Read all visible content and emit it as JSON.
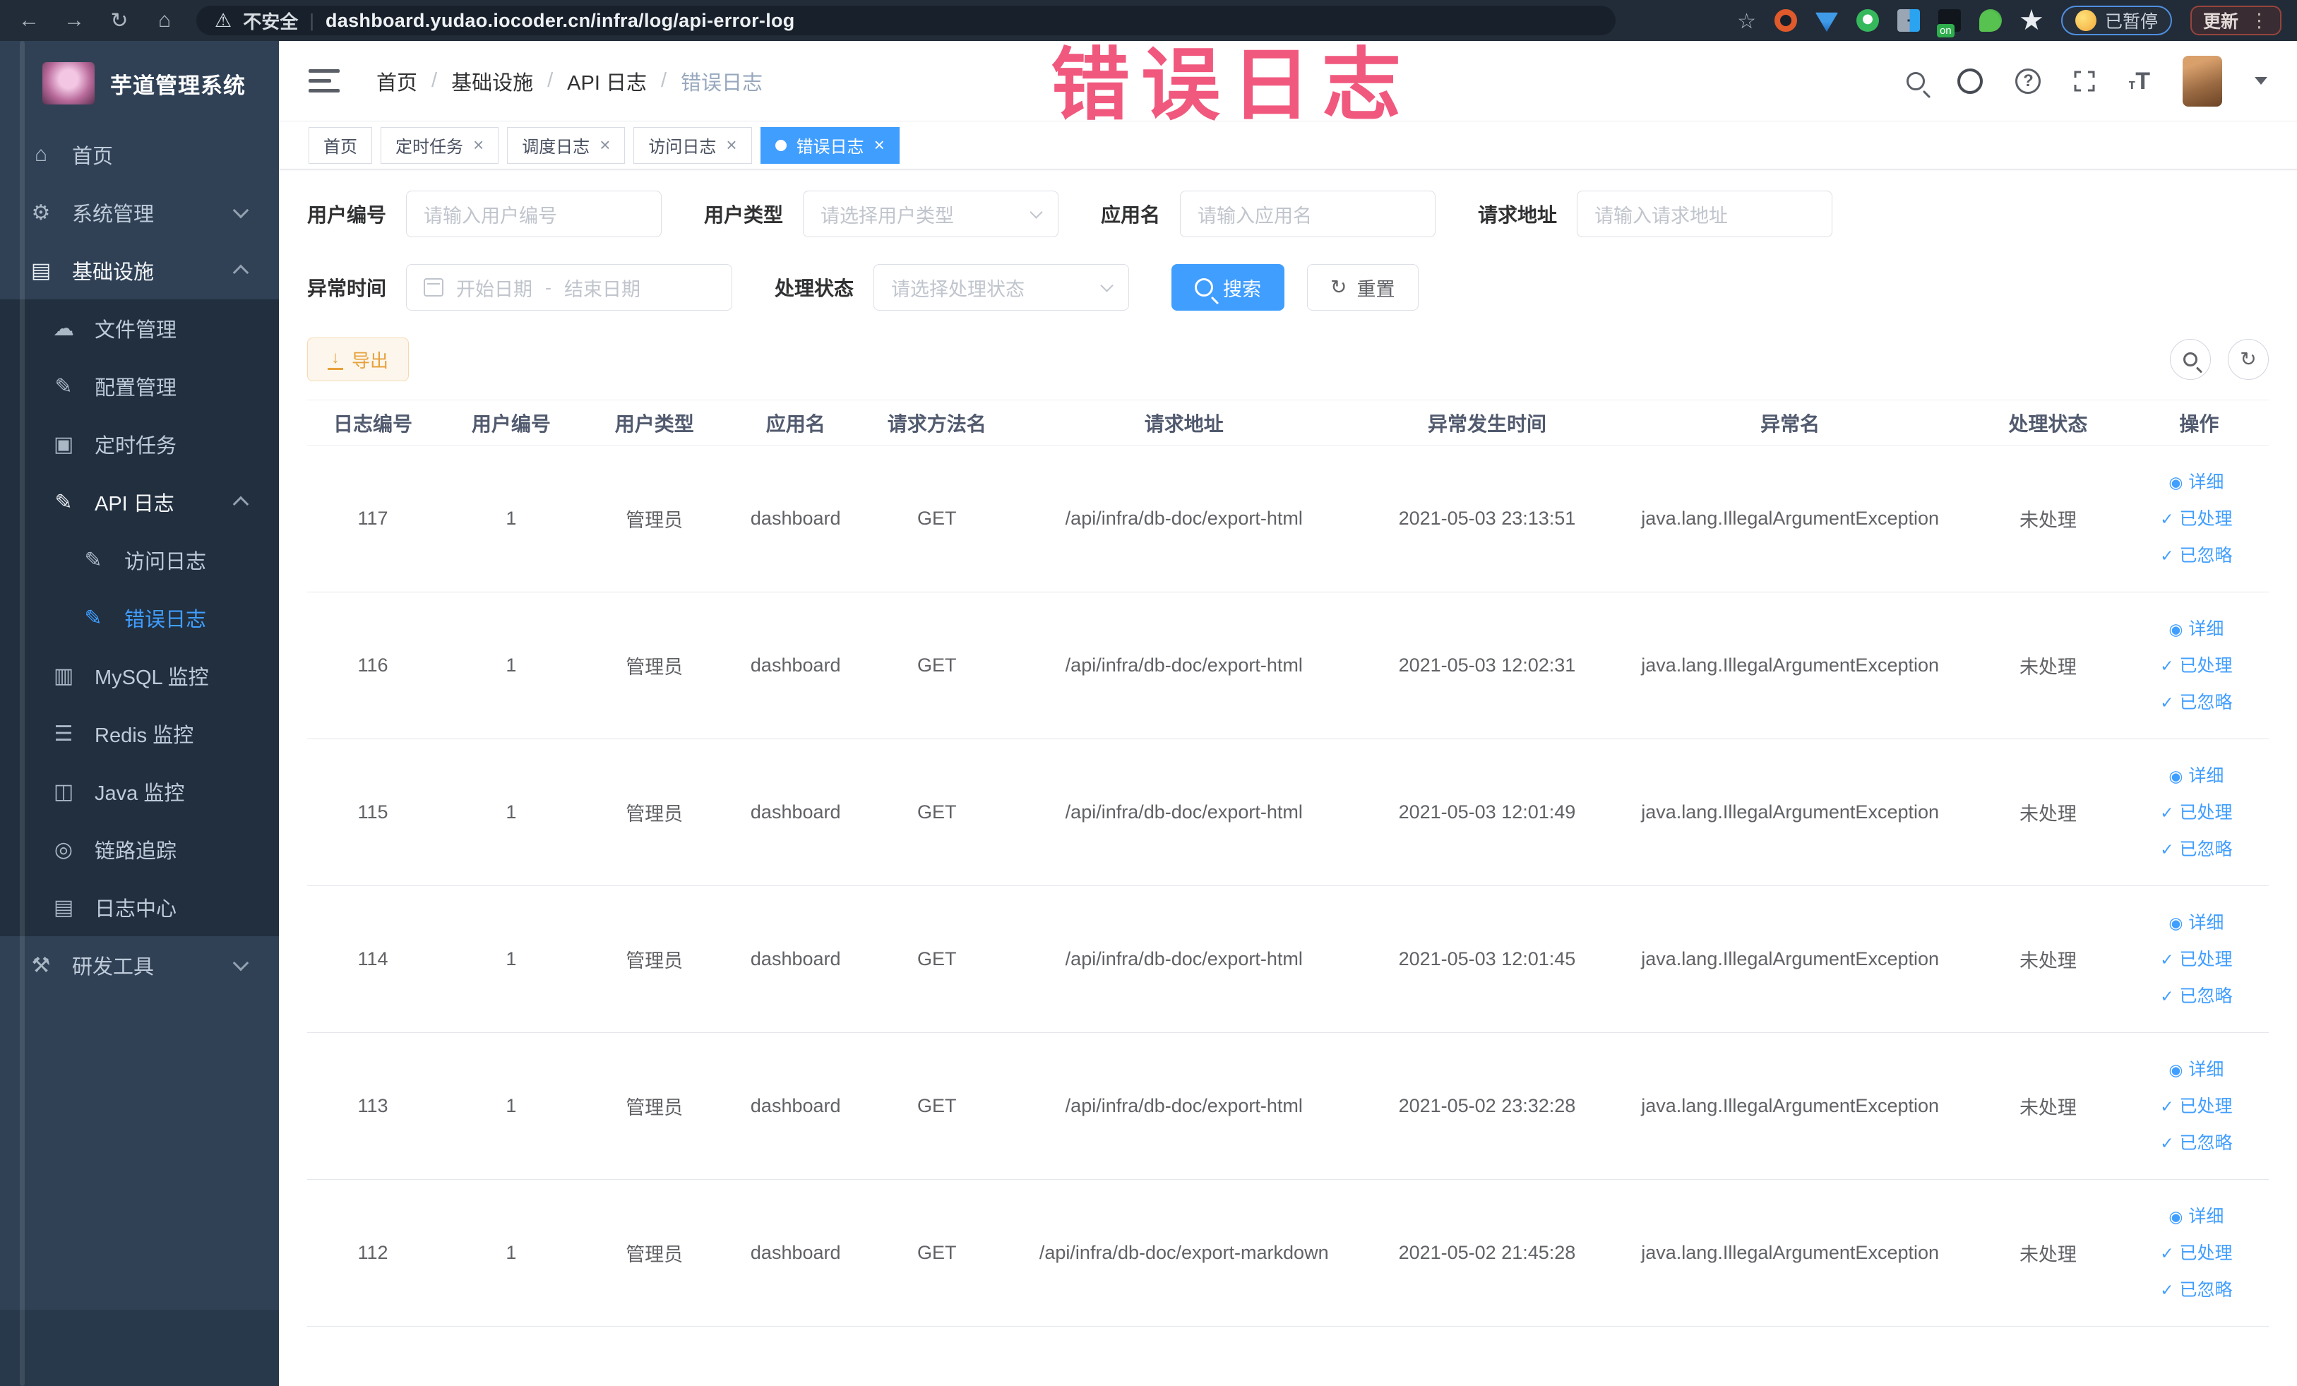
{
  "overlay": {
    "text": "错误日志"
  },
  "browser": {
    "security_label": "不安全",
    "url": "dashboard.yudao.iocoder.cn/infra/log/api-error-log",
    "paused_badge": "已暂停",
    "update_button": "更新"
  },
  "sidebar": {
    "title": "芋道管理系统",
    "items": [
      {
        "label": "首页",
        "icon": "home-icon",
        "glyph": "⌂",
        "level": 1,
        "sub": false
      },
      {
        "label": "系统管理",
        "icon": "gear-icon",
        "glyph": "⚙",
        "level": 1,
        "sub": false,
        "chevron": "down"
      },
      {
        "label": "基础设施",
        "icon": "monitor-icon",
        "glyph": "▤",
        "level": 1,
        "sub": false,
        "chevron": "up",
        "open": true
      },
      {
        "label": "文件管理",
        "icon": "cloud-upload-icon",
        "glyph": "☁",
        "level": 2,
        "sub": true
      },
      {
        "label": "配置管理",
        "icon": "edit-icon",
        "glyph": "✎",
        "level": 2,
        "sub": true
      },
      {
        "label": "定时任务",
        "icon": "task-icon",
        "glyph": "▣",
        "level": 2,
        "sub": true
      },
      {
        "label": "API 日志",
        "icon": "api-log-icon",
        "glyph": "✎",
        "level": 2,
        "sub": true,
        "chevron": "up",
        "open": true
      },
      {
        "label": "访问日志",
        "icon": "access-log-icon",
        "glyph": "✎",
        "level": 3,
        "sub": true
      },
      {
        "label": "错误日志",
        "icon": "error-log-icon",
        "glyph": "✎",
        "level": 3,
        "sub": true,
        "active": true
      },
      {
        "label": "MySQL 监控",
        "icon": "mysql-icon",
        "glyph": "▥",
        "level": 2,
        "sub": true
      },
      {
        "label": "Redis 监控",
        "icon": "redis-icon",
        "glyph": "☰",
        "level": 2,
        "sub": true
      },
      {
        "label": "Java 监控",
        "icon": "java-icon",
        "glyph": "◫",
        "level": 2,
        "sub": true
      },
      {
        "label": "链路追踪",
        "icon": "trace-icon",
        "glyph": "◎",
        "level": 2,
        "sub": true
      },
      {
        "label": "日志中心",
        "icon": "log-center-icon",
        "glyph": "▤",
        "level": 2,
        "sub": true
      },
      {
        "label": "研发工具",
        "icon": "toolbox-icon",
        "glyph": "⚒",
        "level": 1,
        "sub": false,
        "chevron": "down"
      }
    ]
  },
  "breadcrumb": {
    "items": [
      "首页",
      "基础设施",
      "API 日志",
      "错误日志"
    ]
  },
  "tags": [
    {
      "label": "首页",
      "closable": false,
      "active": false
    },
    {
      "label": "定时任务",
      "closable": true,
      "active": false
    },
    {
      "label": "调度日志",
      "closable": true,
      "active": false
    },
    {
      "label": "访问日志",
      "closable": true,
      "active": false
    },
    {
      "label": "错误日志",
      "closable": true,
      "active": true
    }
  ],
  "filters": {
    "user_id": {
      "label": "用户编号",
      "placeholder": "请输入用户编号"
    },
    "user_type": {
      "label": "用户类型",
      "placeholder": "请选择用户类型"
    },
    "app_name": {
      "label": "应用名",
      "placeholder": "请输入应用名"
    },
    "request_url": {
      "label": "请求地址",
      "placeholder": "请输入请求地址"
    },
    "exception_time": {
      "label": "异常时间",
      "start_placeholder": "开始日期",
      "separator": "-",
      "end_placeholder": "结束日期"
    },
    "process_status": {
      "label": "处理状态",
      "placeholder": "请选择处理状态"
    },
    "search_button": "搜索",
    "reset_button": "重置"
  },
  "toolbar": {
    "export_button": "导出"
  },
  "table": {
    "columns": [
      "日志编号",
      "用户编号",
      "用户类型",
      "应用名",
      "请求方法名",
      "请求地址",
      "异常发生时间",
      "异常名",
      "处理状态",
      "操作"
    ],
    "col_widths": [
      "6.7%",
      "7.4%",
      "7.2%",
      "7.2%",
      "7.2%",
      "18%",
      "12.9%",
      "18%",
      "8.3%",
      "7.1%"
    ],
    "actions": [
      {
        "label": "详细",
        "icon": "eye-icon",
        "glyph": "◉"
      },
      {
        "label": "已处理",
        "icon": "check-icon",
        "glyph": "✓"
      },
      {
        "label": "已忽略",
        "icon": "check-icon",
        "glyph": "✓"
      }
    ],
    "rows": [
      {
        "id": "117",
        "user_id": "1",
        "user_type": "管理员",
        "app": "dashboard",
        "method": "GET",
        "url": "/api/infra/db-doc/export-html",
        "time": "2021-05-03 23:13:51",
        "exception": "java.lang.IllegalArgumentException",
        "status": "未处理"
      },
      {
        "id": "116",
        "user_id": "1",
        "user_type": "管理员",
        "app": "dashboard",
        "method": "GET",
        "url": "/api/infra/db-doc/export-html",
        "time": "2021-05-03 12:02:31",
        "exception": "java.lang.IllegalArgumentException",
        "status": "未处理"
      },
      {
        "id": "115",
        "user_id": "1",
        "user_type": "管理员",
        "app": "dashboard",
        "method": "GET",
        "url": "/api/infra/db-doc/export-html",
        "time": "2021-05-03 12:01:49",
        "exception": "java.lang.IllegalArgumentException",
        "status": "未处理"
      },
      {
        "id": "114",
        "user_id": "1",
        "user_type": "管理员",
        "app": "dashboard",
        "method": "GET",
        "url": "/api/infra/db-doc/export-html",
        "time": "2021-05-03 12:01:45",
        "exception": "java.lang.IllegalArgumentException",
        "status": "未处理"
      },
      {
        "id": "113",
        "user_id": "1",
        "user_type": "管理员",
        "app": "dashboard",
        "method": "GET",
        "url": "/api/infra/db-doc/export-html",
        "time": "2021-05-02 23:32:28",
        "exception": "java.lang.IllegalArgumentException",
        "status": "未处理"
      },
      {
        "id": "112",
        "user_id": "1",
        "user_type": "管理员",
        "app": "dashboard",
        "method": "GET",
        "url": "/api/infra/db-doc/export-markdown",
        "time": "2021-05-02 21:45:28",
        "exception": "java.lang.IllegalArgumentException",
        "status": "未处理"
      }
    ]
  },
  "colors": {
    "primary": "#409eff",
    "warning": "#e6a23c",
    "overlay_pink": "#f04a73",
    "sidebar_bg": "#304156",
    "submenu_bg": "#212f3f"
  }
}
